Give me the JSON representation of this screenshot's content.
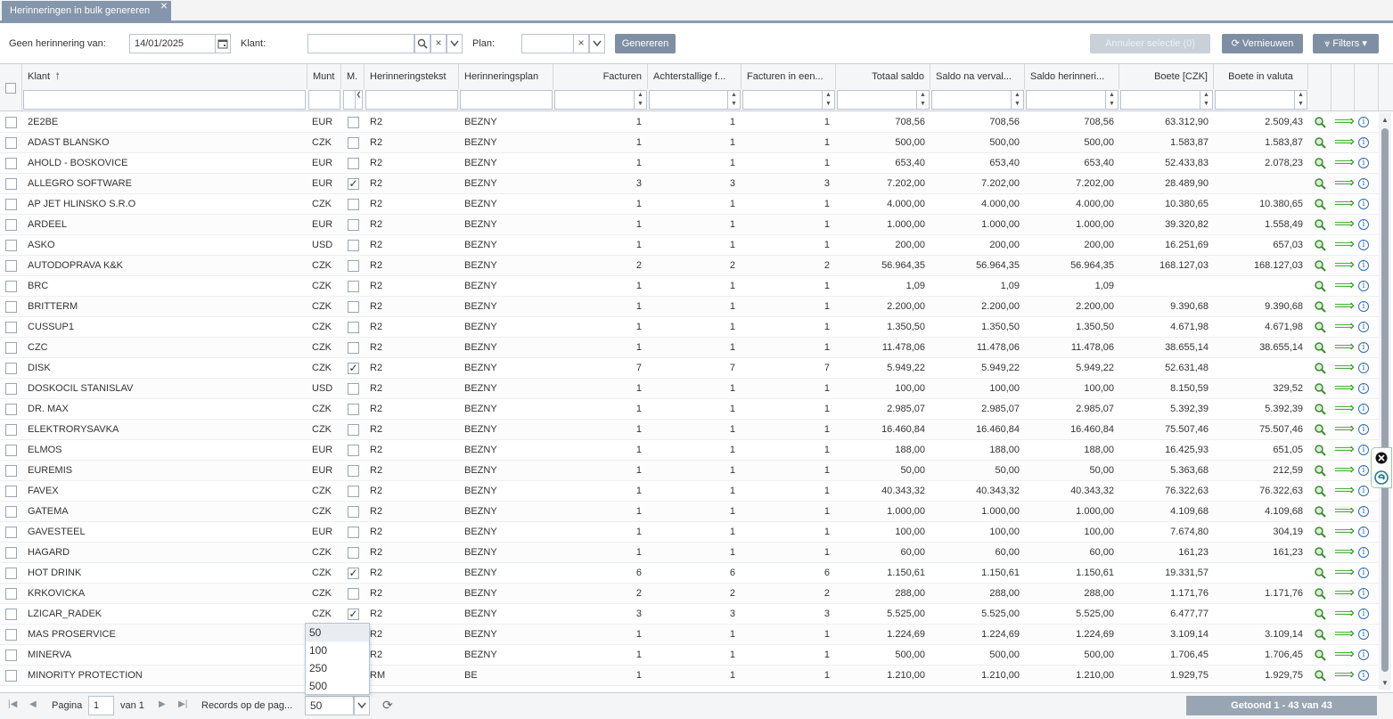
{
  "tab": {
    "label": "Herinneringen in bulk genereren",
    "close": "×"
  },
  "toolbar": {
    "no_reminder_label": "Geen herinnering van:",
    "no_reminder_value": "14/01/2025",
    "customer_label": "Klant:",
    "customer_value": "",
    "plan_label": "Plan:",
    "plan_value": "",
    "generate_label": "Genereren",
    "cancel_selection_label": "Annuleer selectie (0)",
    "refresh_label": "Vernieuwen",
    "filters_label": "Filters"
  },
  "columns": {
    "klant": "Klant",
    "munt": "Munt",
    "m": "M.",
    "herinneringstekst": "Herinneringstekst",
    "herinneringsplan": "Herinneringsplan",
    "facturen": "Facturen",
    "achterstallige": "Achterstallige f...",
    "facturen_in_een": "Facturen in een...",
    "totaal_saldo": "Totaal saldo",
    "saldo_na_verval": "Saldo na verval...",
    "saldo_herinneri": "Saldo herinneri...",
    "boete_czk": "Boete [CZK]",
    "boete_valuta": "Boete in valuta"
  },
  "rows": [
    {
      "klant": "2E2BE",
      "munt": "EUR",
      "m": false,
      "tekst": "R2",
      "plan": "BEZNY",
      "f": "1",
      "a": "1",
      "e": "1",
      "totaal": "708,56",
      "na": "708,56",
      "her": "708,56",
      "boete": "63.312,90",
      "valuta": "2.509,43"
    },
    {
      "klant": "ADAST BLANSKO",
      "munt": "CZK",
      "m": false,
      "tekst": "R2",
      "plan": "BEZNY",
      "f": "1",
      "a": "1",
      "e": "1",
      "totaal": "500,00",
      "na": "500,00",
      "her": "500,00",
      "boete": "1.583,87",
      "valuta": "1.583,87"
    },
    {
      "klant": "AHOLD - BOSKOVICE",
      "munt": "EUR",
      "m": false,
      "tekst": "R2",
      "plan": "BEZNY",
      "f": "1",
      "a": "1",
      "e": "1",
      "totaal": "653,40",
      "na": "653,40",
      "her": "653,40",
      "boete": "52.433,83",
      "valuta": "2.078,23"
    },
    {
      "klant": "ALLEGRO SOFTWARE",
      "munt": "EUR",
      "m": true,
      "tekst": "R2",
      "plan": "BEZNY",
      "f": "3",
      "a": "3",
      "e": "3",
      "totaal": "7.202,00",
      "na": "7.202,00",
      "her": "7.202,00",
      "boete": "28.489,90",
      "valuta": ""
    },
    {
      "klant": "AP JET HLINSKO S.R.O",
      "munt": "CZK",
      "m": false,
      "tekst": "R2",
      "plan": "BEZNY",
      "f": "1",
      "a": "1",
      "e": "1",
      "totaal": "4.000,00",
      "na": "4.000,00",
      "her": "4.000,00",
      "boete": "10.380,65",
      "valuta": "10.380,65"
    },
    {
      "klant": "ARDEEL",
      "munt": "EUR",
      "m": false,
      "tekst": "R2",
      "plan": "BEZNY",
      "f": "1",
      "a": "1",
      "e": "1",
      "totaal": "1.000,00",
      "na": "1.000,00",
      "her": "1.000,00",
      "boete": "39.320,82",
      "valuta": "1.558,49"
    },
    {
      "klant": "ASKO",
      "munt": "USD",
      "m": false,
      "tekst": "R2",
      "plan": "BEZNY",
      "f": "1",
      "a": "1",
      "e": "1",
      "totaal": "200,00",
      "na": "200,00",
      "her": "200,00",
      "boete": "16.251,69",
      "valuta": "657,03"
    },
    {
      "klant": "AUTODOPRAVA K&K",
      "munt": "CZK",
      "m": false,
      "tekst": "R2",
      "plan": "BEZNY",
      "f": "2",
      "a": "2",
      "e": "2",
      "totaal": "56.964,35",
      "na": "56.964,35",
      "her": "56.964,35",
      "boete": "168.127,03",
      "valuta": "168.127,03"
    },
    {
      "klant": "BRC",
      "munt": "CZK",
      "m": false,
      "tekst": "R2",
      "plan": "BEZNY",
      "f": "1",
      "a": "1",
      "e": "1",
      "totaal": "1,09",
      "na": "1,09",
      "her": "1,09",
      "boete": "",
      "valuta": ""
    },
    {
      "klant": "BRITTERM",
      "munt": "CZK",
      "m": false,
      "tekst": "R2",
      "plan": "BEZNY",
      "f": "1",
      "a": "1",
      "e": "1",
      "totaal": "2.200,00",
      "na": "2.200,00",
      "her": "2.200,00",
      "boete": "9.390,68",
      "valuta": "9.390,68"
    },
    {
      "klant": "CUSSUP1",
      "munt": "CZK",
      "m": false,
      "tekst": "R2",
      "plan": "BEZNY",
      "f": "1",
      "a": "1",
      "e": "1",
      "totaal": "1.350,50",
      "na": "1.350,50",
      "her": "1.350,50",
      "boete": "4.671,98",
      "valuta": "4.671,98"
    },
    {
      "klant": "CZC",
      "munt": "CZK",
      "m": false,
      "tekst": "R2",
      "plan": "BEZNY",
      "f": "1",
      "a": "1",
      "e": "1",
      "totaal": "11.478,06",
      "na": "11.478,06",
      "her": "11.478,06",
      "boete": "38.655,14",
      "valuta": "38.655,14"
    },
    {
      "klant": "DISK",
      "munt": "CZK",
      "m": true,
      "tekst": "R2",
      "plan": "BEZNY",
      "f": "7",
      "a": "7",
      "e": "7",
      "totaal": "5.949,22",
      "na": "5.949,22",
      "her": "5.949,22",
      "boete": "52.631,48",
      "valuta": ""
    },
    {
      "klant": "DOSKOCIL STANISLAV",
      "munt": "USD",
      "m": false,
      "tekst": "R2",
      "plan": "BEZNY",
      "f": "1",
      "a": "1",
      "e": "1",
      "totaal": "100,00",
      "na": "100,00",
      "her": "100,00",
      "boete": "8.150,59",
      "valuta": "329,52"
    },
    {
      "klant": "DR. MAX",
      "munt": "CZK",
      "m": false,
      "tekst": "R2",
      "plan": "BEZNY",
      "f": "1",
      "a": "1",
      "e": "1",
      "totaal": "2.985,07",
      "na": "2.985,07",
      "her": "2.985,07",
      "boete": "5.392,39",
      "valuta": "5.392,39"
    },
    {
      "klant": "ELEKTRORYSAVKA",
      "munt": "CZK",
      "m": false,
      "tekst": "R2",
      "plan": "BEZNY",
      "f": "1",
      "a": "1",
      "e": "1",
      "totaal": "16.460,84",
      "na": "16.460,84",
      "her": "16.460,84",
      "boete": "75.507,46",
      "valuta": "75.507,46"
    },
    {
      "klant": "ELMOS",
      "munt": "EUR",
      "m": false,
      "tekst": "R2",
      "plan": "BEZNY",
      "f": "1",
      "a": "1",
      "e": "1",
      "totaal": "188,00",
      "na": "188,00",
      "her": "188,00",
      "boete": "16.425,93",
      "valuta": "651,05"
    },
    {
      "klant": "EUREMIS",
      "munt": "EUR",
      "m": false,
      "tekst": "R2",
      "plan": "BEZNY",
      "f": "1",
      "a": "1",
      "e": "1",
      "totaal": "50,00",
      "na": "50,00",
      "her": "50,00",
      "boete": "5.363,68",
      "valuta": "212,59"
    },
    {
      "klant": "FAVEX",
      "munt": "CZK",
      "m": false,
      "tekst": "R2",
      "plan": "BEZNY",
      "f": "1",
      "a": "1",
      "e": "1",
      "totaal": "40.343,32",
      "na": "40.343,32",
      "her": "40.343,32",
      "boete": "76.322,63",
      "valuta": "76.322,63"
    },
    {
      "klant": "GATEMA",
      "munt": "CZK",
      "m": false,
      "tekst": "R2",
      "plan": "BEZNY",
      "f": "1",
      "a": "1",
      "e": "1",
      "totaal": "1.000,00",
      "na": "1.000,00",
      "her": "1.000,00",
      "boete": "4.109,68",
      "valuta": "4.109,68"
    },
    {
      "klant": "GAVESTEEL",
      "munt": "EUR",
      "m": false,
      "tekst": "R2",
      "plan": "BEZNY",
      "f": "1",
      "a": "1",
      "e": "1",
      "totaal": "100,00",
      "na": "100,00",
      "her": "100,00",
      "boete": "7.674,80",
      "valuta": "304,19"
    },
    {
      "klant": "HAGARD",
      "munt": "CZK",
      "m": false,
      "tekst": "R2",
      "plan": "BEZNY",
      "f": "1",
      "a": "1",
      "e": "1",
      "totaal": "60,00",
      "na": "60,00",
      "her": "60,00",
      "boete": "161,23",
      "valuta": "161,23"
    },
    {
      "klant": "HOT DRINK",
      "munt": "CZK",
      "m": true,
      "tekst": "R2",
      "plan": "BEZNY",
      "f": "6",
      "a": "6",
      "e": "6",
      "totaal": "1.150,61",
      "na": "1.150,61",
      "her": "1.150,61",
      "boete": "19.331,57",
      "valuta": ""
    },
    {
      "klant": "KRKOVICKA",
      "munt": "CZK",
      "m": false,
      "tekst": "R2",
      "plan": "BEZNY",
      "f": "2",
      "a": "2",
      "e": "2",
      "totaal": "288,00",
      "na": "288,00",
      "her": "288,00",
      "boete": "1.171,76",
      "valuta": "1.171,76"
    },
    {
      "klant": "LZICAR_RADEK",
      "munt": "CZK",
      "m": true,
      "tekst": "R2",
      "plan": "BEZNY",
      "f": "3",
      "a": "3",
      "e": "3",
      "totaal": "5.525,00",
      "na": "5.525,00",
      "her": "5.525,00",
      "boete": "6.477,77",
      "valuta": ""
    },
    {
      "klant": "MAS PROSERVICE",
      "munt": "",
      "m": null,
      "tekst": "R2",
      "plan": "BEZNY",
      "f": "1",
      "a": "1",
      "e": "1",
      "totaal": "1.224,69",
      "na": "1.224,69",
      "her": "1.224,69",
      "boete": "3.109,14",
      "valuta": "3.109,14"
    },
    {
      "klant": "MINERVA",
      "munt": "",
      "m": null,
      "tekst": "R2",
      "plan": "BEZNY",
      "f": "1",
      "a": "1",
      "e": "1",
      "totaal": "500,00",
      "na": "500,00",
      "her": "500,00",
      "boete": "1.706,45",
      "valuta": "1.706,45"
    },
    {
      "klant": "MINORITY PROTECTION",
      "munt": "",
      "m": null,
      "tekst": "RM",
      "plan": "BE",
      "f": "1",
      "a": "1",
      "e": "1",
      "totaal": "1.210,00",
      "na": "1.210,00",
      "her": "1.210,00",
      "boete": "1.929,75",
      "valuta": "1.929,75"
    }
  ],
  "pager": {
    "page_label": "Pagina",
    "page_value": "1",
    "of_label": "van 1",
    "records_label": "Records op de pag...",
    "records_value": "50",
    "options": [
      "50",
      "100",
      "250",
      "500"
    ],
    "counter": "Getoond 1 - 43 van 43"
  },
  "icons": {
    "search": "magnifier-icon",
    "arrow": "⟹",
    "info": "i"
  },
  "colors": {
    "accent": "#8496ab",
    "arrow": "#3aa02a",
    "info": "#2e6db5"
  }
}
